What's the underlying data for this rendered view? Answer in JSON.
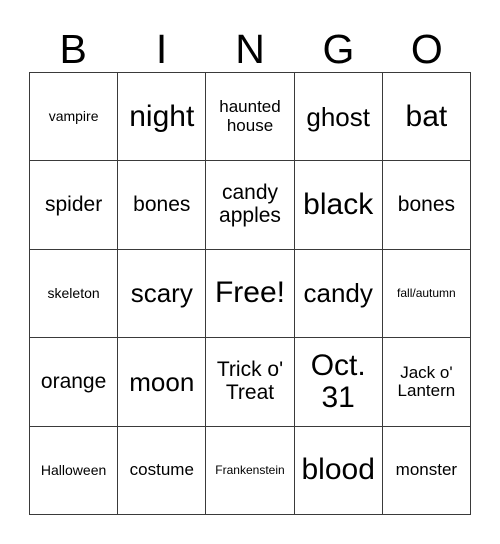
{
  "card": {
    "title": "BINGO",
    "headers": [
      "B",
      "I",
      "N",
      "G",
      "O"
    ],
    "grid_colors": {
      "border": "#3a3a3a",
      "background": "#ffffff",
      "text": "#000000"
    },
    "rows": [
      [
        {
          "text": "vampire",
          "size": "s"
        },
        {
          "text": "night",
          "size": "xxl"
        },
        {
          "text": "haunted house",
          "size": "m"
        },
        {
          "text": "ghost",
          "size": "xl"
        },
        {
          "text": "bat",
          "size": "xxl"
        }
      ],
      [
        {
          "text": "spider",
          "size": "l"
        },
        {
          "text": "bones",
          "size": "l"
        },
        {
          "text": "candy apples",
          "size": "l"
        },
        {
          "text": "black",
          "size": "xxl"
        },
        {
          "text": "bones",
          "size": "l"
        }
      ],
      [
        {
          "text": "skeleton",
          "size": "s"
        },
        {
          "text": "scary",
          "size": "xl"
        },
        {
          "text": "Free!",
          "size": "xxl"
        },
        {
          "text": "candy",
          "size": "xl"
        },
        {
          "text": "fall/autumn",
          "size": "xs"
        }
      ],
      [
        {
          "text": "orange",
          "size": "l"
        },
        {
          "text": "moon",
          "size": "xl"
        },
        {
          "text": "Trick o' Treat",
          "size": "l"
        },
        {
          "text": "Oct. 31",
          "size": "xxl"
        },
        {
          "text": "Jack o' Lantern",
          "size": "m"
        }
      ],
      [
        {
          "text": "Halloween",
          "size": "s"
        },
        {
          "text": "costume",
          "size": "m"
        },
        {
          "text": "Frankenstein",
          "size": "xs"
        },
        {
          "text": "blood",
          "size": "xxl"
        },
        {
          "text": "monster",
          "size": "m"
        }
      ]
    ]
  }
}
